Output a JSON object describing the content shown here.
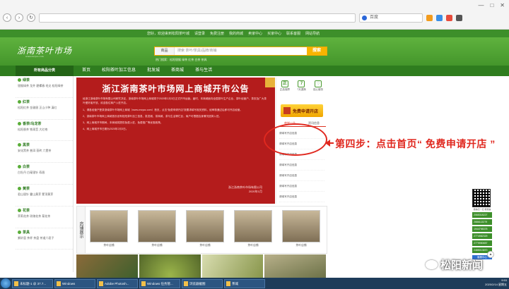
{
  "browser": {
    "url": "",
    "search_placeholder": "百度",
    "window_controls": [
      "—",
      "□",
      "✕"
    ]
  },
  "site": {
    "top_links": [
      "您好，欢迎来到松阳茶叶城",
      "请登录",
      "免费注册",
      "我的商城",
      "卖家中心",
      "买家中心",
      "联系客服",
      "网站导航"
    ],
    "logo_text": "浙南茶叶市场",
    "logo_sub": "www.zncysc.com",
    "search": {
      "category": "商品",
      "placeholder": "搜索 茶叶/茶具/品牌/商铺",
      "button": "搜索"
    },
    "hot_words": "热门搜索：松阳银猴  绿茶  红茶  白茶  茶具",
    "nav": {
      "category_title": "所有商品分类",
      "items": [
        "首页",
        "松阳茶叶加工信息",
        "批发城",
        "茶商城",
        "茶与生活"
      ]
    },
    "categories": [
      {
        "name": "绿茶",
        "subs": "银猴绿茶  龙井  碧螺春  毛尖  松阳绿茶"
      },
      {
        "name": "红茶",
        "subs": "松阳红茶  金骏眉  正山小种  滇红"
      },
      {
        "name": "香茶/乌龙茶",
        "subs": "松阳香茶  铁观音  大红袍"
      },
      {
        "name": "黑茶",
        "subs": "安化黑茶  普洱  茯砖  六堡茶"
      },
      {
        "name": "白茶",
        "subs": "白牡丹  白毫银针  寿眉"
      },
      {
        "name": "黄茶",
        "subs": "君山银针  霍山黄芽  蒙顶黄芽"
      },
      {
        "name": "花茶",
        "subs": "茉莉花茶  玫瑰花茶  菊花茶"
      },
      {
        "name": "茶具",
        "subs": "紫砂壶  茶杯  茶盘  茶道六君子"
      }
    ],
    "banner": {
      "title": "浙江浙南茶叶市场网上商城开市公告",
      "paragraphs": [
        "经浙江浙南茶叶市场有限公司研究决定，浙南茶叶市场网上商城将于2020年2月3日正式开市运营。届时，本商城面向全国茶叶生产企业、茶叶经营户、茶农及广大茶叶爱好者开放，欢迎各位商户入驻开店。",
        "1、请各经营户登录浙南茶叶市场网上商城（www.zncysc.com）首页，点击“免费申请开店”按要求填写相关资料，经审核通过后即可开店经营。",
        "2、浙南茶叶市场网上商城首页设有松阳茶叶加工信息、批发城、茶商城、茶与生活等栏目，商户可根据自身情况选择入驻。",
        "3、网上商城开市期间，本商城将提供免费入驻、免费推广等优惠政策。",
        "4、网上商城开市日期为2020年2月3日。"
      ],
      "sign_org": "浙江浙南茶叶市场有限公司",
      "sign_date": "2020年1月"
    },
    "right_panel": {
      "services": [
        {
          "icon": "正",
          "label": "正品保障"
        },
        {
          "icon": "7",
          "label": "7天退换"
        },
        {
          "icon": "♡",
          "label": "贴心服务"
        }
      ],
      "open_shop": "免费申请开店",
      "tabs": [
        "商城公告",
        "资讯信息"
      ],
      "notices": [
        "请填写开店信息",
        "请填写开店信息",
        "请填写开店信息",
        "请填写开店信息",
        "请填写开店信息",
        "请填写开店信息",
        "请填写开店信息"
      ]
    },
    "step_text": "第四步：点击首页“ 免费申请开店 ”",
    "stores": {
      "title": "店铺展示",
      "items": [
        "茶叶店铺",
        "茶叶店铺",
        "茶叶店铺",
        "茶叶店铺",
        "茶叶店铺"
      ]
    },
    "float": {
      "qr_caption": "微信扫一扫 有惊喜",
      "qq": [
        "2065318227",
        "2686113279",
        "1944798375",
        "2774982329",
        "2779950657",
        "2485013870"
      ],
      "kefu": "客服中心"
    }
  },
  "watermark": "松阳新闻",
  "taskbar": {
    "tasks": [
      "未标题-1 @ 37.7...",
      "Windows",
      "Adobe Photosh...",
      "Windows 任务管...",
      "浏览器截图",
      "茶城"
    ],
    "time": "9:53",
    "date": "2020/2/14 星期五"
  },
  "colors": {
    "brand_green": "#44962b",
    "banner_red": "#b41c1c",
    "annotation_red": "#e0281f",
    "search_orange": "#f8b400"
  }
}
